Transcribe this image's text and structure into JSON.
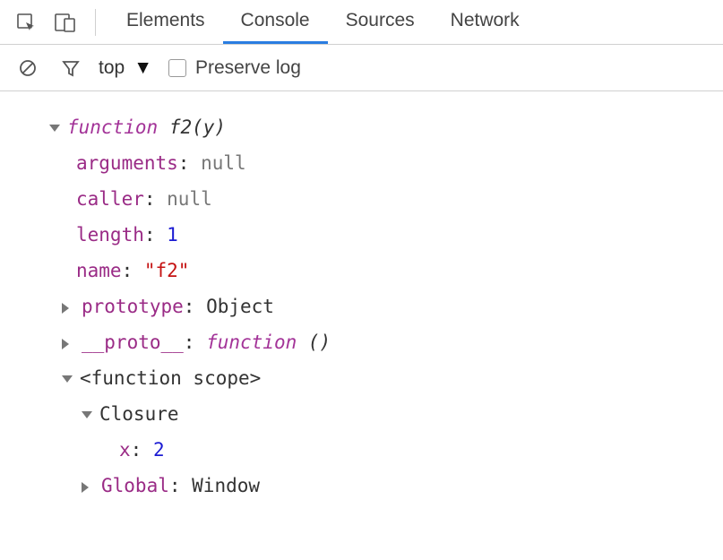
{
  "tabs": {
    "elements": "Elements",
    "console": "Console",
    "sources": "Sources",
    "network": "Network"
  },
  "toolbar": {
    "context": "top",
    "preserve_label": "Preserve log"
  },
  "fn": {
    "keyword": "function",
    "signature": "f2(y)",
    "props": {
      "arguments": {
        "key": "arguments",
        "value": "null"
      },
      "caller": {
        "key": "caller",
        "value": "null"
      },
      "length": {
        "key": "length",
        "value": "1"
      },
      "name": {
        "key": "name",
        "value": "\"f2\""
      },
      "prototype": {
        "key": "prototype",
        "value": "Object"
      },
      "proto": {
        "key": "__proto__",
        "kw": "function",
        "sig": "()"
      }
    },
    "scope_label": "<function scope>",
    "closure_label": "Closure",
    "closure_var": {
      "key": "x",
      "value": "2"
    },
    "global": {
      "key": "Global",
      "value": "Window"
    }
  }
}
